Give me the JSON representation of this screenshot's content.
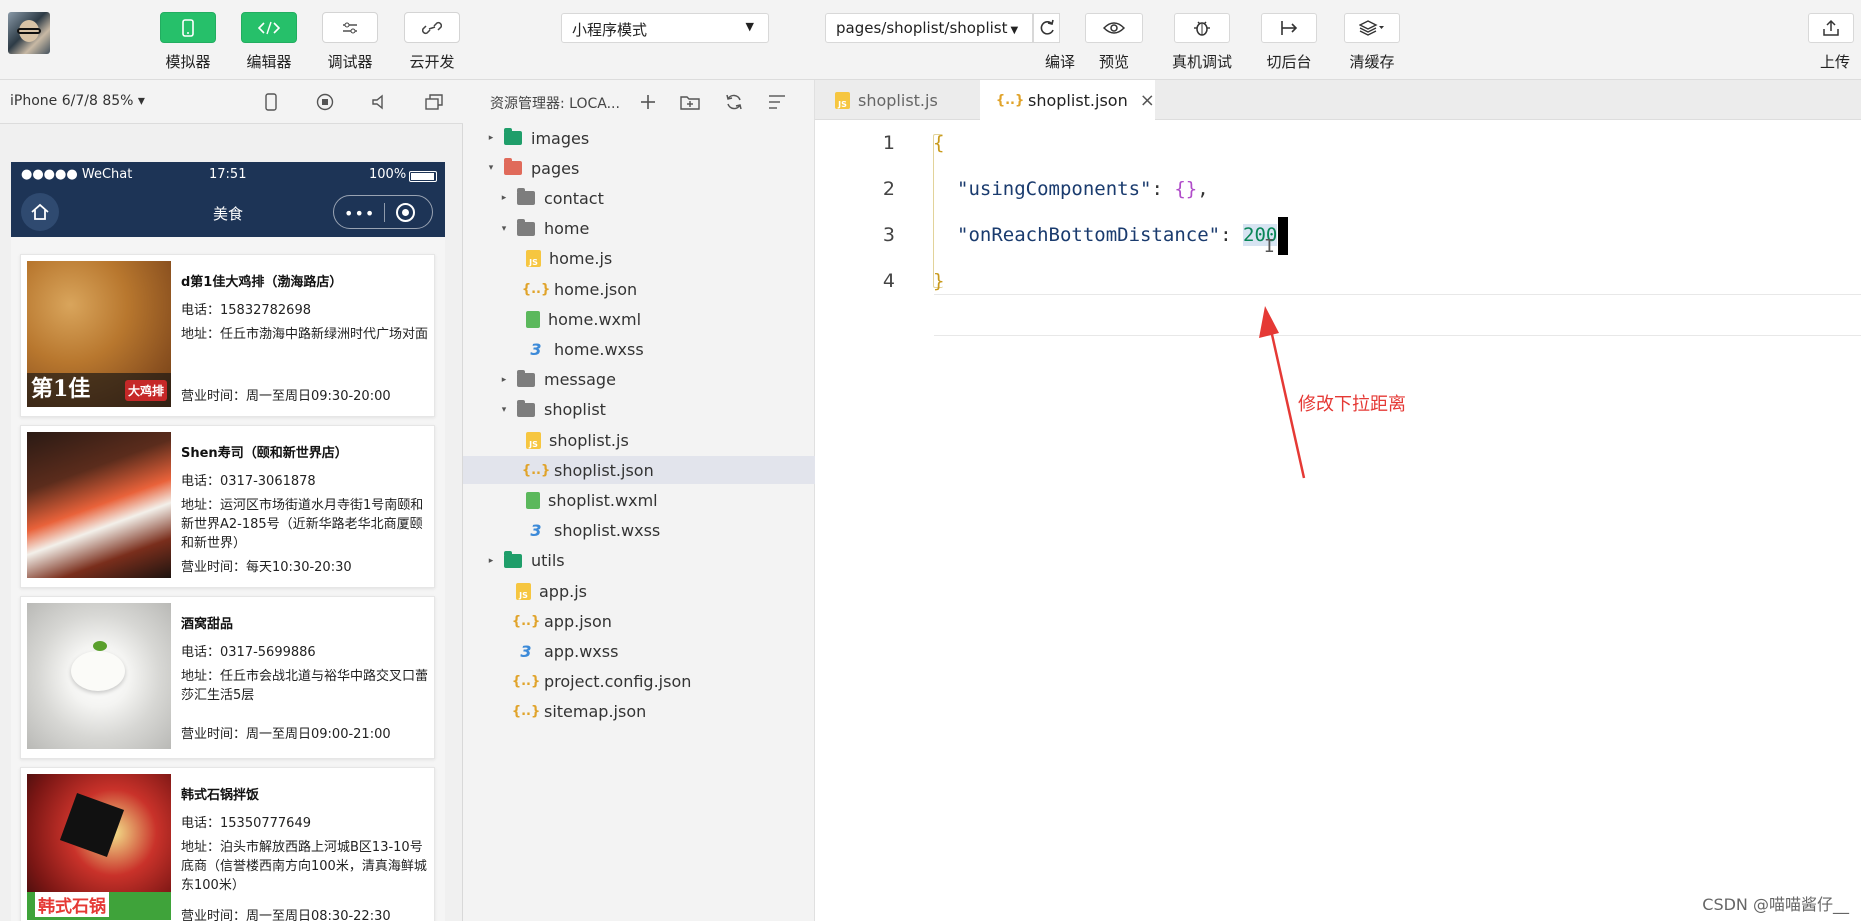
{
  "toolbar": {
    "simulator": "模拟器",
    "editor": "编辑器",
    "debugger": "调试器",
    "cloud": "云开发",
    "mode": "小程序模式",
    "page_path": "pages/shoplist/shoplist",
    "compile": "编译",
    "preview": "预览",
    "device_debug": "真机调试",
    "background": "切后台",
    "clear_cache": "清缓存",
    "upload": "上传"
  },
  "simulator": {
    "device": "iPhone 6/7/8 85% ▾",
    "status": {
      "carrier": "●●●●● WeChat",
      "time": "17:51",
      "battery": "100%"
    },
    "nav_title": "美食",
    "shops": [
      {
        "name": "d第1佳大鸡排（渤海路店）",
        "phone": "电话：15832782698",
        "address": "地址：任丘市渤海中路新绿洲时代广场对面",
        "hours": "营业时间：周一至周日09:30-20:00"
      },
      {
        "name": "Shen寿司（颐和新世界店）",
        "phone": "电话：0317-3061878",
        "address": "地址：运河区市场街道水月寺街1号南颐和新世界A2-185号（近新华路老华北商厦颐和新世界）",
        "hours": "营业时间：每天10:30-20:30"
      },
      {
        "name": "酒窝甜品",
        "phone": "电话：0317-5699886",
        "address": "地址：任丘市会战北道与裕华中路交叉口蕾莎汇生活5层",
        "hours": "营业时间：周一至周日09:00-21:00"
      },
      {
        "name": "韩式石锅拌饭",
        "phone": "电话：15350777649",
        "address": "地址：泊头市解放西路上河城B区13-10号底商（信誉楼西南方向100米，清真海鲜城东100米）",
        "hours": "营业时间：周一至周日08:30-22:30"
      }
    ],
    "img_text": {
      "shop1": "第1佳",
      "shop1b": "大鸡排",
      "shop4": "韩式石锅"
    }
  },
  "explorer": {
    "title": "资源管理器: LOCA...",
    "tree": [
      {
        "label": "images",
        "type": "folder-green",
        "depth": 0,
        "arrow": "▸"
      },
      {
        "label": "pages",
        "type": "folder-red",
        "depth": 0,
        "arrow": "▾"
      },
      {
        "label": "contact",
        "type": "folder-gray",
        "depth": 1,
        "arrow": "▸"
      },
      {
        "label": "home",
        "type": "folder-gray-open",
        "depth": 1,
        "arrow": "▾"
      },
      {
        "label": "home.js",
        "type": "js",
        "depth": 2,
        "arrow": ""
      },
      {
        "label": "home.json",
        "type": "json",
        "depth": 2,
        "arrow": ""
      },
      {
        "label": "home.wxml",
        "type": "wxml",
        "depth": 2,
        "arrow": ""
      },
      {
        "label": "home.wxss",
        "type": "wxss",
        "depth": 2,
        "arrow": ""
      },
      {
        "label": "message",
        "type": "folder-gray",
        "depth": 1,
        "arrow": "▸"
      },
      {
        "label": "shoplist",
        "type": "folder-gray-open",
        "depth": 1,
        "arrow": "▾"
      },
      {
        "label": "shoplist.js",
        "type": "js",
        "depth": 2,
        "arrow": ""
      },
      {
        "label": "shoplist.json",
        "type": "json",
        "depth": 2,
        "arrow": "",
        "selected": true
      },
      {
        "label": "shoplist.wxml",
        "type": "wxml",
        "depth": 2,
        "arrow": ""
      },
      {
        "label": "shoplist.wxss",
        "type": "wxss",
        "depth": 2,
        "arrow": ""
      },
      {
        "label": "utils",
        "type": "folder-green",
        "depth": 0,
        "arrow": "▸"
      },
      {
        "label": "app.js",
        "type": "js",
        "depth": 1,
        "arrow": ""
      },
      {
        "label": "app.json",
        "type": "json",
        "depth": 1,
        "arrow": ""
      },
      {
        "label": "app.wxss",
        "type": "wxss",
        "depth": 1,
        "arrow": ""
      },
      {
        "label": "project.config.json",
        "type": "json",
        "depth": 1,
        "arrow": ""
      },
      {
        "label": "sitemap.json",
        "type": "json",
        "depth": 1,
        "arrow": ""
      }
    ]
  },
  "editor": {
    "tabs": [
      {
        "label": "shoplist.js",
        "active": false
      },
      {
        "label": "shoplist.json",
        "active": true,
        "close": "×"
      }
    ],
    "line_numbers": [
      "1",
      "2",
      "3",
      "4"
    ],
    "code": {
      "open_brace": "{",
      "key1": "\"usingComponents\"",
      "colon": ": ",
      "obj": "{}",
      "comma": ",",
      "key2": "\"onReachBottomDistance\"",
      "value": "200",
      "close_brace": "}"
    },
    "annotation": "修改下拉距离",
    "annotation_color": "#e53935"
  },
  "watermark": "CSDN @喵喵酱仔__"
}
